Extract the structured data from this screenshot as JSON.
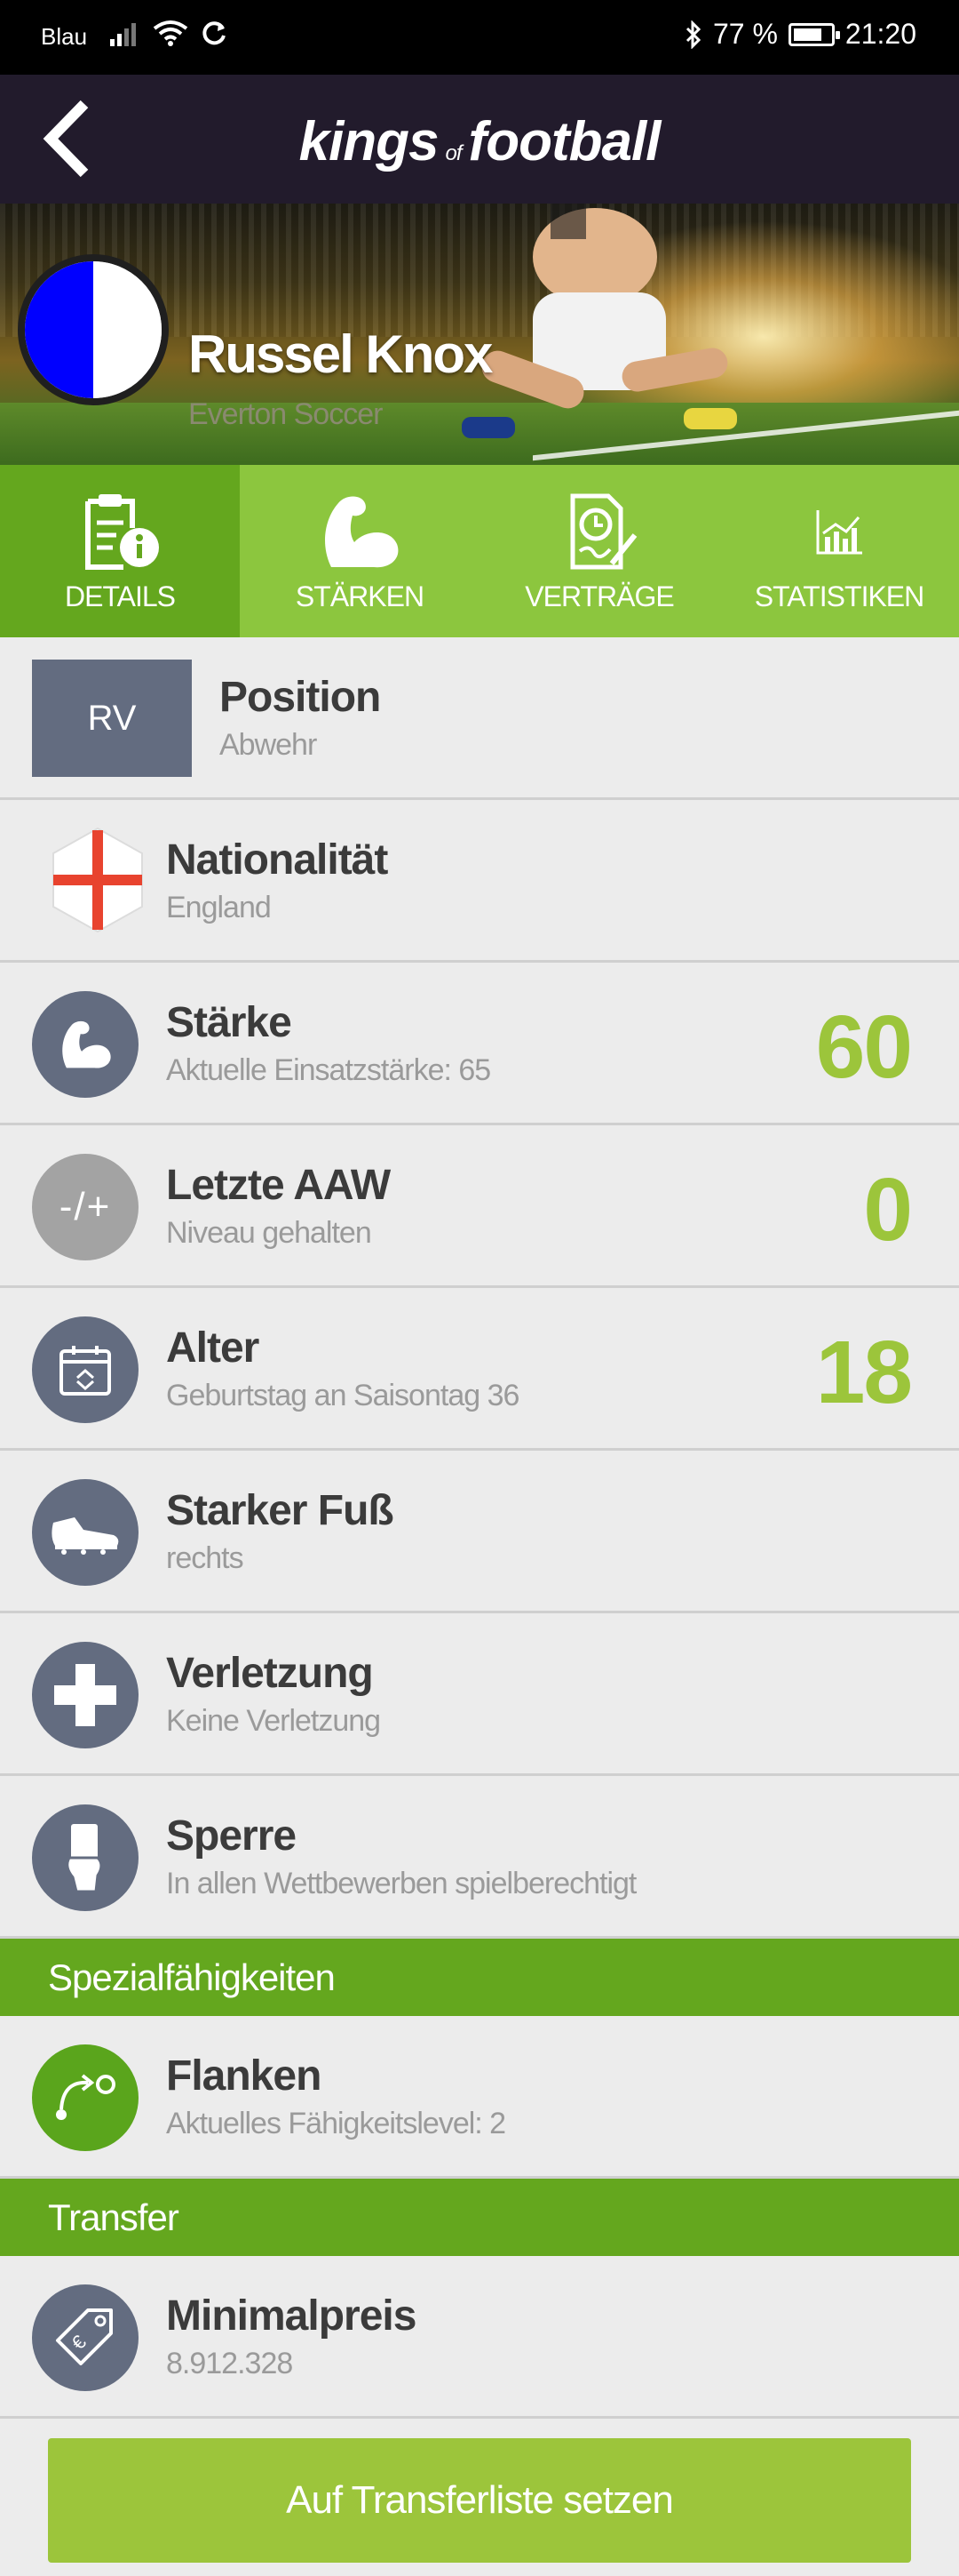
{
  "status_bar": {
    "carrier": "Blau",
    "battery": "77 %",
    "time": "21:20",
    "battery_level": 0.77
  },
  "header": {
    "logo_main": "kings",
    "logo_of": "of",
    "logo_end": "football"
  },
  "player": {
    "name": "Russel Knox",
    "club": "Everton Soccer",
    "club_colors": [
      "#0000ff",
      "#ffffff"
    ]
  },
  "tabs": [
    {
      "label": "DETAILS",
      "icon": "document-info-icon",
      "active": true
    },
    {
      "label": "STÄRKEN",
      "icon": "flexed-arm-icon",
      "active": false
    },
    {
      "label": "VERTRÄGE",
      "icon": "contract-clock-icon",
      "active": false
    },
    {
      "label": "STATISTIKEN",
      "icon": "bar-chart-icon",
      "active": false
    }
  ],
  "details": {
    "position": {
      "badge": "RV",
      "title": "Position",
      "sub": "Abwehr"
    },
    "nationality": {
      "title": "Nationalität",
      "sub": "England",
      "icon": "england-flag-icon"
    },
    "strength": {
      "title": "Stärke",
      "sub": "Aktuelle Einsatzstärke: 65",
      "value": "60",
      "icon": "flexed-arm-icon"
    },
    "aaw": {
      "title": "Letzte AAW",
      "sub": "Niveau gehalten",
      "value": "0",
      "icon_text": "-/+"
    },
    "age": {
      "title": "Alter",
      "sub": "Geburtstag an Saisontag 36",
      "value": "18",
      "icon": "calendar-icon"
    },
    "foot": {
      "title": "Starker Fuß",
      "sub": "rechts",
      "icon": "football-boot-icon"
    },
    "injury": {
      "title": "Verletzung",
      "sub": "Keine Verletzung",
      "icon": "cross-icon"
    },
    "suspension": {
      "title": "Sperre",
      "sub": "In allen Wettbewerben spielberechtigt",
      "icon": "card-hand-icon"
    }
  },
  "special": {
    "header": "Spezialfähigkeiten",
    "items": [
      {
        "title": "Flanken",
        "sub": "Aktuelles Fähigkeitslevel: 2",
        "icon": "cross-path-icon"
      }
    ]
  },
  "transfer": {
    "header": "Transfer",
    "min_price": {
      "title": "Minimalpreis",
      "sub": "8.912.328",
      "icon": "price-tag-icon"
    },
    "button": "Auf Transferliste setzen"
  },
  "colors": {
    "accent_green": "#8cc63e",
    "dark_green": "#64a71e",
    "value_green": "#9cc53b",
    "header_bg": "#221b2c",
    "icon_slate": "#636c80"
  }
}
